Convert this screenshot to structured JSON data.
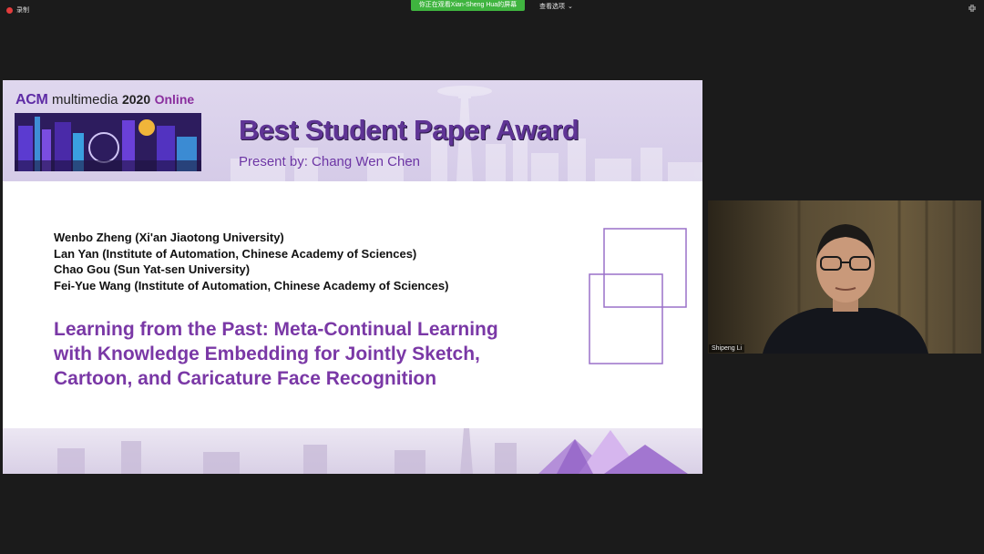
{
  "toolbar": {
    "recording_label": "录制",
    "share_banner": "你正在观看Xian-Sheng Hua的屏幕",
    "view_options_label": "查看选项"
  },
  "slide": {
    "logo": {
      "acm": "ACM",
      "multimedia": "multimedia",
      "year": "2020",
      "online": "Online"
    },
    "award_title": "Best Student Paper Award",
    "presenter": "Present by: Chang Wen Chen",
    "authors": [
      "Wenbo Zheng (Xi'an Jiaotong University)",
      "Lan Yan (Institute of Automation, Chinese Academy of Sciences)",
      "Chao Gou (Sun Yat-sen University)",
      "Fei-Yue Wang (Institute of Automation, Chinese Academy of Sciences)"
    ],
    "paper_title_lines": [
      "Learning from the Past: Meta-Continual Learning",
      "with Knowledge Embedding for Jointly Sketch,",
      "Cartoon, and Caricature Face Recognition"
    ]
  },
  "participant": {
    "name": "Shipeng Li"
  },
  "colors": {
    "share_banner_bg": "#3fb43f",
    "slide_accent_purple": "#7a38a6",
    "header_lavender": "#dcd3ec",
    "background": "#1b1b1b"
  },
  "icons": {
    "recording": "record-dot-icon",
    "view_options": "chevron-down-icon",
    "fullscreen": "collapse-arrows-icon"
  }
}
